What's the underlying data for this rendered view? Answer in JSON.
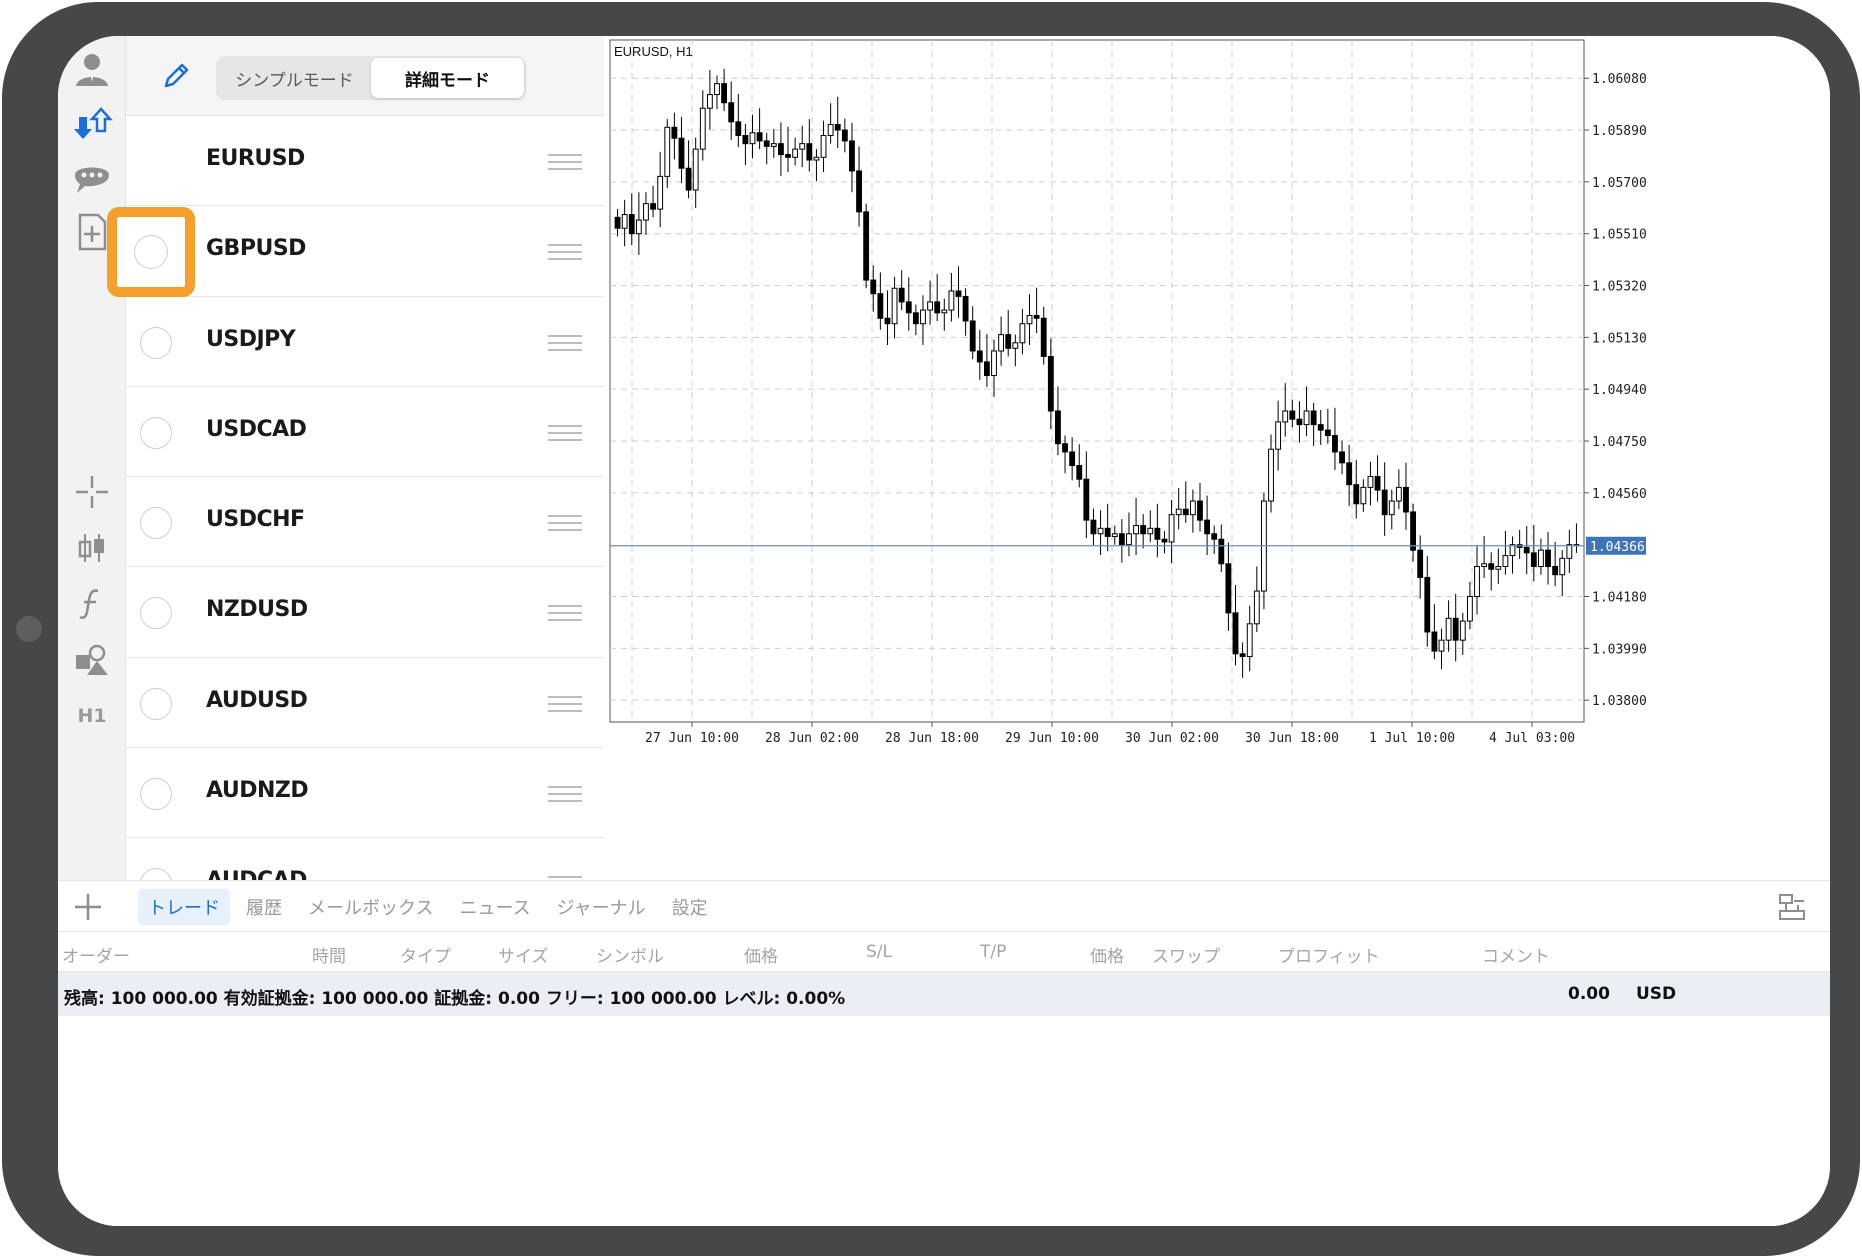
{
  "mode_toggle": {
    "simple_label": "シンプルモード",
    "detail_label": "詳細モード",
    "active": "detail"
  },
  "symbols": [
    {
      "name": "EURUSD",
      "has_radio": false
    },
    {
      "name": "GBPUSD",
      "has_radio": true
    },
    {
      "name": "USDJPY",
      "has_radio": true
    },
    {
      "name": "USDCAD",
      "has_radio": true
    },
    {
      "name": "USDCHF",
      "has_radio": true
    },
    {
      "name": "NZDUSD",
      "has_radio": true
    },
    {
      "name": "AUDUSD",
      "has_radio": true
    },
    {
      "name": "AUDNZD",
      "has_radio": true
    },
    {
      "name": "AUDCAD",
      "has_radio": true
    }
  ],
  "rail": {
    "timeframe_label": "H1"
  },
  "chart": {
    "title": "EURUSD, H1",
    "current_price": "1.04366",
    "price_axis": [
      "1.06080",
      "1.05890",
      "1.05700",
      "1.05510",
      "1.05320",
      "1.05130",
      "1.04940",
      "1.04750",
      "1.04560",
      "1.04180",
      "1.03990",
      "1.03800"
    ],
    "time_axis": [
      "27 Jun 10:00",
      "28 Jun 02:00",
      "28 Jun 18:00",
      "29 Jun 10:00",
      "30 Jun 02:00",
      "30 Jun 18:00",
      "1 Jul 10:00",
      "4 Jul 03:00"
    ],
    "colors": {
      "grid": "#cfcfcf",
      "candle": "#000000",
      "price_line": "#6f8fb5",
      "price_tag_bg": "#3f74b8",
      "price_tag_text": "#ffffff"
    }
  },
  "chart_data": {
    "type": "candlestick",
    "title": "EURUSD, H1",
    "ylim": [
      1.0372,
      1.0622
    ],
    "ticks_y": [
      1.0608,
      1.0589,
      1.057,
      1.0551,
      1.0532,
      1.0513,
      1.0494,
      1.0475,
      1.0456,
      1.0418,
      1.0399,
      1.038
    ],
    "ticks_x": [
      "27 Jun 10:00",
      "28 Jun 02:00",
      "28 Jun 18:00",
      "29 Jun 10:00",
      "30 Jun 02:00",
      "30 Jun 18:00",
      "1 Jul 10:00",
      "4 Jul 03:00"
    ],
    "current_price": 1.04366,
    "series": [
      {
        "name": "EURUSD",
        "close": [
          1.0553,
          1.0558,
          1.0551,
          1.0556,
          1.0562,
          1.056,
          1.0572,
          1.059,
          1.0586,
          1.0575,
          1.0567,
          1.0582,
          1.0597,
          1.0602,
          1.0606,
          1.0599,
          1.0592,
          1.0587,
          1.0584,
          1.0588,
          1.0585,
          1.0583,
          1.0584,
          1.058,
          1.0579,
          1.0582,
          1.0584,
          1.0578,
          1.0579,
          1.0587,
          1.0591,
          1.0589,
          1.0585,
          1.0574,
          1.0559,
          1.0534,
          1.0529,
          1.052,
          1.0518,
          1.0531,
          1.0526,
          1.0522,
          1.0518,
          1.0523,
          1.0526,
          1.0522,
          1.0523,
          1.053,
          1.0528,
          1.0519,
          1.0508,
          1.0504,
          1.0499,
          1.0508,
          1.0514,
          1.0509,
          1.0511,
          1.0518,
          1.0521,
          1.052,
          1.0506,
          1.0486,
          1.0474,
          1.0471,
          1.0466,
          1.0461,
          1.0446,
          1.0441,
          1.0443,
          1.044,
          1.0441,
          1.0437,
          1.0441,
          1.0444,
          1.0441,
          1.0443,
          1.0439,
          1.0438,
          1.0448,
          1.045,
          1.0448,
          1.0453,
          1.0446,
          1.0441,
          1.0439,
          1.043,
          1.0412,
          1.0397,
          1.0396,
          1.0408,
          1.042,
          1.0453,
          1.0472,
          1.0482,
          1.0486,
          1.0483,
          1.0481,
          1.0486,
          1.0481,
          1.0479,
          1.0477,
          1.0471,
          1.0467,
          1.0459,
          1.0452,
          1.0458,
          1.0462,
          1.0457,
          1.0448,
          1.0453,
          1.0458,
          1.0449,
          1.0435,
          1.0425,
          1.0405,
          1.0398,
          1.0402,
          1.041,
          1.0402,
          1.0409,
          1.0418,
          1.0429,
          1.043,
          1.0428,
          1.0429,
          1.0433,
          1.0437,
          1.0436,
          1.0434,
          1.0429,
          1.0435,
          1.0429,
          1.0426,
          1.0432,
          1.0437,
          1.0437
        ]
      }
    ]
  },
  "toolbox": {
    "tabs": [
      "トレード",
      "履歴",
      "メールボックス",
      "ニュース",
      "ジャーナル",
      "設定"
    ],
    "active_tab": "トレード",
    "columns": [
      "オーダー",
      "時間",
      "タイプ",
      "サイズ",
      "シンボル",
      "価格",
      "S/L",
      "T/P",
      "価格",
      "スワップ",
      "プロフィット",
      "コメント"
    ],
    "account_summary": "残高: 100 000.00 有効証拠金: 100 000.00 証拠金: 0.00 フリー: 100 000.00 レベル: 0.00%",
    "profit_value": "0.00",
    "currency": "USD"
  }
}
